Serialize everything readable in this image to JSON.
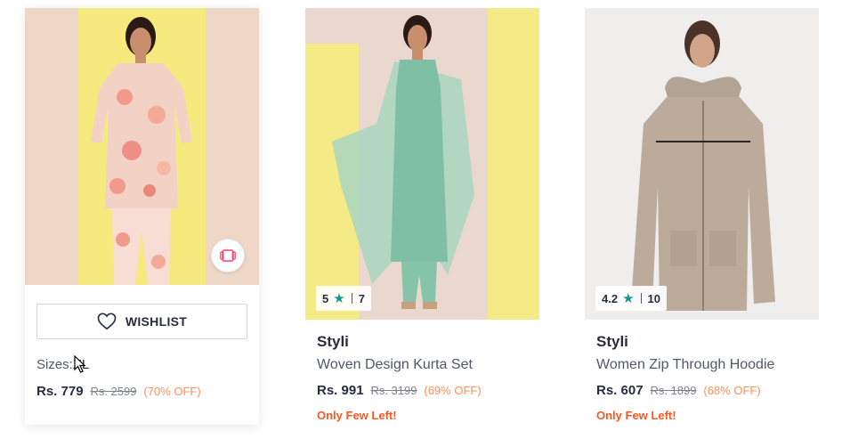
{
  "products": [
    {
      "wishlist_label": "WISHLIST",
      "sizes_label": "Sizes:",
      "sizes_value": "XL",
      "price": "Rs. 779",
      "mrp": "Rs. 2599",
      "discount": "(70% OFF)",
      "image_desc_icon": "floral-kurta-set-photo"
    },
    {
      "brand": "Styli",
      "name": "Woven Design Kurta Set",
      "rating": "5",
      "rating_count": "7",
      "price": "Rs. 991",
      "mrp": "Rs. 3199",
      "discount": "(69% OFF)",
      "stock_note": "Only Few Left!"
    },
    {
      "brand": "Styli",
      "name": "Women Zip Through Hoodie",
      "rating": "4.2",
      "rating_count": "10",
      "price": "Rs. 607",
      "mrp": "Rs. 1899",
      "discount": "(68% OFF)",
      "stock_note": "Only Few Left!"
    }
  ],
  "colors": {
    "accent_off": "#ff905a",
    "stock_warning": "#ff5722",
    "rating_star": "#14958f",
    "similar_icon": "#ff3f6c"
  },
  "icons": [
    "heart-outline-icon",
    "view-similar-icon",
    "star-icon",
    "mouse-pointer-icon"
  ]
}
